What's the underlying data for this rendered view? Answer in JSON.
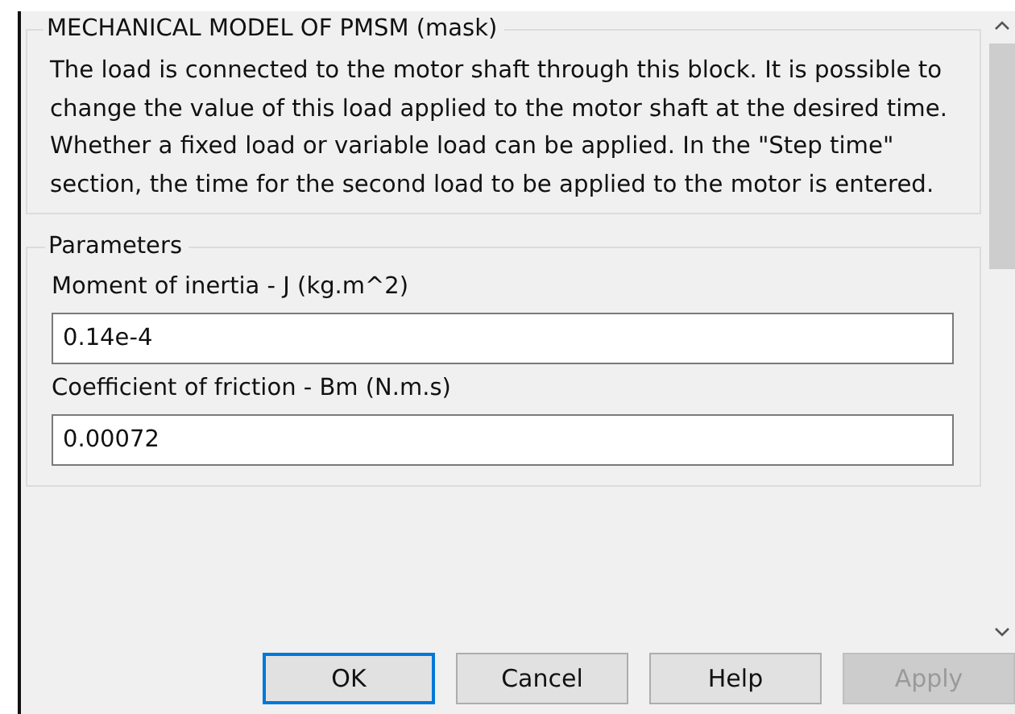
{
  "mask": {
    "title": "MECHANICAL MODEL OF PMSM (mask)",
    "description": "The load is connected to the motor shaft through this block. It is possible to change the value of this load applied to the motor shaft at the desired time. Whether a fixed load or variable load can be applied. In the \"Step time\" section, the time for the second load to be applied to the motor is entered."
  },
  "parameters": {
    "title": "Parameters",
    "fields": [
      {
        "label": "Moment of inertia - J (kg.m^2)",
        "value": "0.14e-4"
      },
      {
        "label": "Coefficient of friction - Bm (N.m.s)",
        "value": "0.00072"
      }
    ]
  },
  "buttons": [
    {
      "label": "OK",
      "focused": true,
      "disabled": false
    },
    {
      "label": "Cancel",
      "focused": false,
      "disabled": false
    },
    {
      "label": "Help",
      "focused": false,
      "disabled": false
    },
    {
      "label": "Apply",
      "focused": false,
      "disabled": true
    }
  ]
}
